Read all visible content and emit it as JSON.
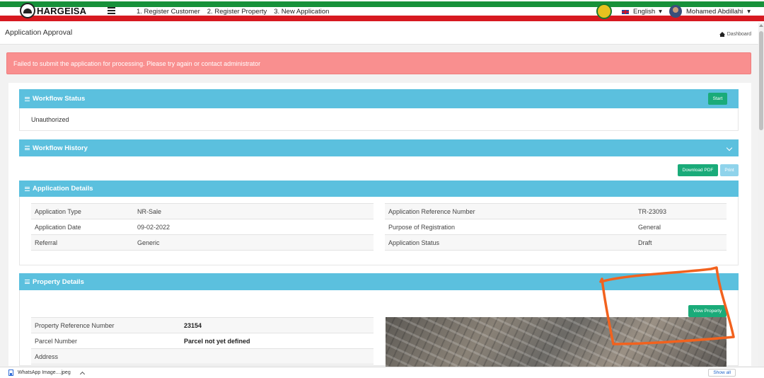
{
  "header": {
    "logo_text": "HARGEISA",
    "nav": [
      "1. Register Customer",
      "2. Register Property",
      "3. New Application"
    ],
    "language": "English",
    "user_name": "Mohamed Abdillahi"
  },
  "page": {
    "title": "Application Approval",
    "breadcrumb": "Dashboard"
  },
  "alert": {
    "message": "Failed to submit the application for processing. Please try again or contact administrator"
  },
  "workflow_status": {
    "title": "Workflow Status",
    "button": "Start",
    "value": "Unauthorized"
  },
  "workflow_history": {
    "title": "Workflow History"
  },
  "actions": {
    "download_pdf": "Download PDF",
    "print": "Print"
  },
  "application_details": {
    "title": "Application Details",
    "left": [
      {
        "label": "Application Type",
        "value": "NR-Sale"
      },
      {
        "label": "Application Date",
        "value": "09-02-2022"
      },
      {
        "label": "Referral",
        "value": "Generic"
      }
    ],
    "right": [
      {
        "label": "Application Reference Number",
        "value": "TR-23093"
      },
      {
        "label": "Purpose of Registration",
        "value": "General"
      },
      {
        "label": "Application Status",
        "value": "Draft"
      }
    ]
  },
  "property_details": {
    "title": "Property Details",
    "view_button": "View Property",
    "rows": [
      {
        "label": "Property Reference Number",
        "value": "23154"
      },
      {
        "label": "Parcel Number",
        "value": "Parcel not yet defined"
      },
      {
        "label": "Address",
        "value": ""
      }
    ]
  },
  "download_bar": {
    "file_name": "WhatsApp Image....jpeg",
    "show_all": "Show all"
  },
  "colors": {
    "panel_header": "#5bc0de",
    "alert_bg": "#f98f8f",
    "button_green": "#1aab79",
    "annotation": "#f2621e"
  }
}
